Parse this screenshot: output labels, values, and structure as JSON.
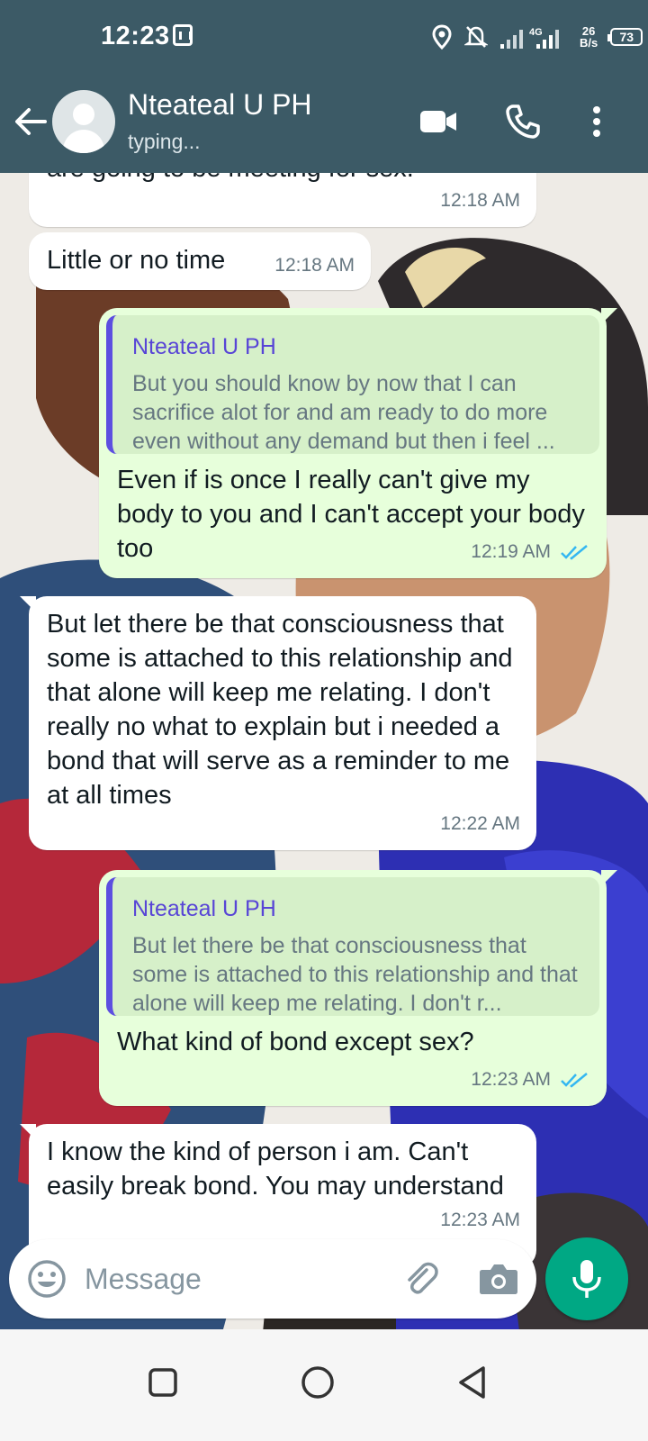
{
  "status_bar": {
    "time": "12:23",
    "network_type": "4G",
    "speed_value": "26",
    "speed_unit": "B/s",
    "battery": "73"
  },
  "header": {
    "contact_name": "Nteateal U PH",
    "contact_status": "typing..."
  },
  "messages": [
    {
      "direction": "incoming",
      "text": "are going to be meeting for sex.",
      "time": "12:18 AM"
    },
    {
      "direction": "incoming",
      "text": "Little or no time",
      "time": "12:18 AM"
    },
    {
      "direction": "outgoing",
      "quote": {
        "name": "Nteateal U PH",
        "text": "But you should know by now that I can sacrifice alot for and am ready to do more even without any demand but then i feel ..."
      },
      "text": "Even if is once I really can't give my body to you and I can't accept your body too",
      "time": "12:19 AM",
      "read": true
    },
    {
      "direction": "incoming",
      "text": "But let there be that consciousness that some is attached to this relationship and that alone will keep me relating. I don't really no what to explain but i needed a bond that will serve as a reminder to me at all times",
      "time": "12:22 AM"
    },
    {
      "direction": "outgoing",
      "quote": {
        "name": "Nteateal U PH",
        "text": "But let there be that consciousness that some is attached to this relationship and that alone will keep me relating. I don't r..."
      },
      "text": "What kind of bond except sex?",
      "time": "12:23 AM",
      "read": true
    },
    {
      "direction": "incoming",
      "text": "I know the kind of person i am. Can't easily break bond. You may understand",
      "time": "12:23 AM"
    }
  ],
  "composer": {
    "placeholder": "Message"
  },
  "colors": {
    "header": "#3c5a66",
    "outgoing_bubble": "#e7ffdb",
    "incoming_bubble": "#ffffff",
    "quote_accent": "#5d4fe0",
    "mic_button": "#00a884",
    "read_ticks": "#34b7f1"
  },
  "icons": {
    "back": "arrow-left-icon",
    "avatar": "default-avatar-icon",
    "video": "video-camera-icon",
    "call": "phone-icon",
    "menu": "more-vertical-icon",
    "emoji": "emoji-icon",
    "attach": "paperclip-icon",
    "camera": "camera-icon",
    "mic": "microphone-icon",
    "nav_recent": "square-icon",
    "nav_home": "circle-icon",
    "nav_back": "triangle-back-icon"
  }
}
